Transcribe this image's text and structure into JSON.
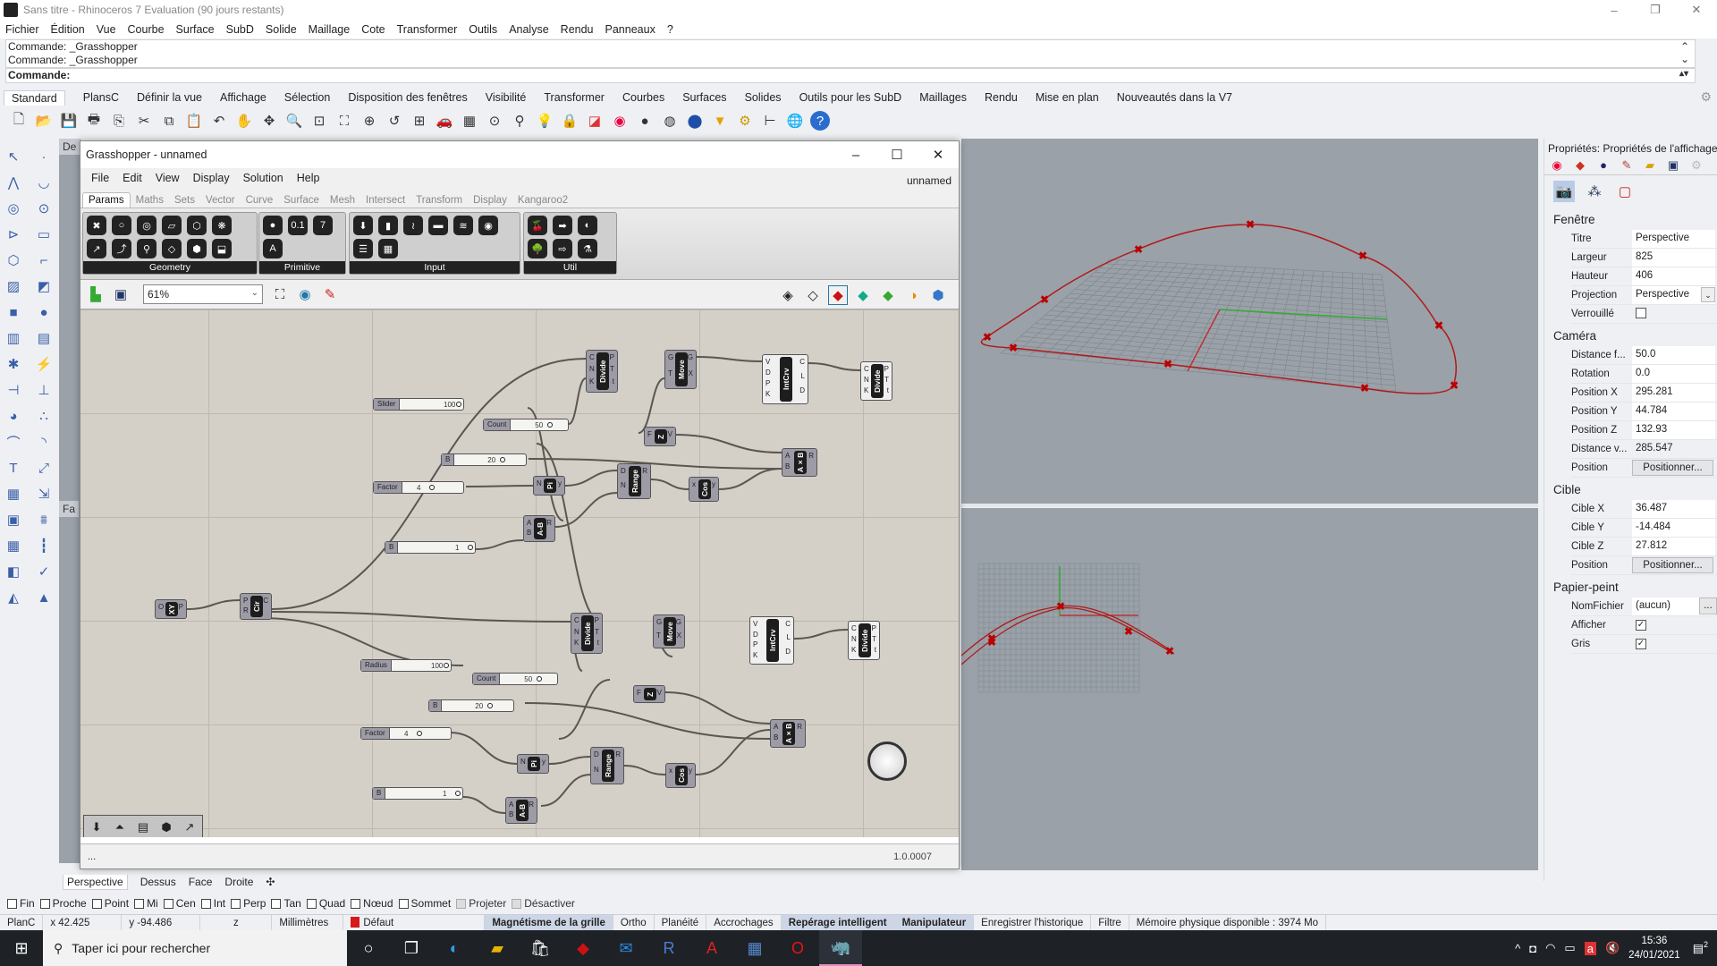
{
  "window": {
    "title": "Sans titre - Rhinoceros 7 Evaluation (90 jours restants)",
    "controls": {
      "minimize": "–",
      "restore": "❐",
      "close": "✕"
    }
  },
  "menubar": [
    "Fichier",
    "Édition",
    "Vue",
    "Courbe",
    "Surface",
    "SubD",
    "Solide",
    "Maillage",
    "Cote",
    "Transformer",
    "Outils",
    "Analyse",
    "Rendu",
    "Panneaux",
    "?"
  ],
  "command": {
    "history": [
      "Commande: _Grasshopper",
      "Commande: _Grasshopper"
    ],
    "prompt": "Commande:"
  },
  "toolbar_tabs": [
    "Standard",
    "PlansC",
    "Définir la vue",
    "Affichage",
    "Sélection",
    "Disposition des fenêtres",
    "Visibilité",
    "Transformer",
    "Courbes",
    "Surfaces",
    "Solides",
    "Outils pour les SubD",
    "Maillages",
    "Rendu",
    "Mise en plan",
    "Nouveautés dans la V7"
  ],
  "toolbar_active_tab": "Standard",
  "standard_toolbar_icons": [
    "new-icon",
    "open-icon",
    "save-icon",
    "print-icon",
    "import-icon",
    "cut-icon",
    "copy-icon",
    "paste-icon",
    "undo-icon",
    "pan-icon",
    "rotate-view-icon",
    "zoom-icon",
    "zoom-window-icon",
    "zoom-extents-icon",
    "zoom-selected-icon",
    "undo-view-icon",
    "viewport-layout-icon",
    "car-icon",
    "grid-icon",
    "osnap-icon",
    "gumball-icon",
    "light-icon",
    "lock-icon",
    "layer-icon",
    "color-wheel-icon",
    "shaded-icon",
    "rendered-icon",
    "sphere-icon",
    "select-icon",
    "options-icon",
    "dimensions-icon",
    "globe-icon",
    "help-icon"
  ],
  "left_tools": [
    [
      "select-arrow-icon",
      "point-icon"
    ],
    [
      "polyline-icon",
      "curve-icon"
    ],
    [
      "circle-icon",
      "ellipse-icon"
    ],
    [
      "arc-icon",
      "rectangle-icon"
    ],
    [
      "polygon-icon",
      "fillet-icon"
    ],
    [
      "surface-points-icon",
      "surface-icon"
    ],
    [
      "box-icon",
      "sphere-solid-icon"
    ],
    [
      "cylinder-icon",
      "mesh-icon"
    ],
    [
      "boolean-icon",
      "explode-icon"
    ],
    [
      "trim-icon",
      "split-icon"
    ],
    [
      "boolean-union-icon",
      "boolean-diff-icon"
    ],
    [
      "offset-icon",
      "fillet-curve-icon"
    ],
    [
      "text-icon",
      "scale-icon"
    ],
    [
      "array-icon",
      "align-icon"
    ],
    [
      "extrude-icon",
      "project-icon"
    ],
    [
      "grid-array-icon",
      "history-icon"
    ],
    [
      "analysis-icon",
      "check-icon"
    ],
    [
      "shapes-icon",
      "render-icon"
    ]
  ],
  "viewport_side_labels": [
    "De",
    "Fa"
  ],
  "viewport_tabs": [
    "Perspective",
    "Dessus",
    "Face",
    "Droite"
  ],
  "viewport_active_tab": "Perspective",
  "osnaps": [
    {
      "label": "Fin",
      "checked": false,
      "enabled": true
    },
    {
      "label": "Proche",
      "checked": false,
      "enabled": true
    },
    {
      "label": "Point",
      "checked": false,
      "enabled": true
    },
    {
      "label": "Mi",
      "checked": false,
      "enabled": true
    },
    {
      "label": "Cen",
      "checked": false,
      "enabled": true
    },
    {
      "label": "Int",
      "checked": false,
      "enabled": true
    },
    {
      "label": "Perp",
      "checked": false,
      "enabled": true
    },
    {
      "label": "Tan",
      "checked": false,
      "enabled": true
    },
    {
      "label": "Quad",
      "checked": false,
      "enabled": true
    },
    {
      "label": "Nœud",
      "checked": false,
      "enabled": true
    },
    {
      "label": "Sommet",
      "checked": false,
      "enabled": true
    },
    {
      "label": "Projeter",
      "checked": false,
      "enabled": false
    },
    {
      "label": "Désactiver",
      "checked": false,
      "enabled": false
    }
  ],
  "statusbar": {
    "cplane": "PlanC",
    "x": "x 42.425",
    "y": "y -94.486",
    "z": "z",
    "units": "Millimètres",
    "layer": "Défaut",
    "layer_color": "#d7191c",
    "toggles": [
      {
        "label": "Magnétisme de la grille",
        "active": true
      },
      {
        "label": "Ortho",
        "active": false
      },
      {
        "label": "Planéité",
        "active": false
      },
      {
        "label": "Accrochages",
        "active": false
      },
      {
        "label": "Repérage intelligent",
        "active": true
      },
      {
        "label": "Manipulateur",
        "active": true
      },
      {
        "label": "Enregistrer l'historique",
        "active": false
      },
      {
        "label": "Filtre",
        "active": false
      }
    ],
    "memory": "Mémoire physique disponible : 3974 Mo"
  },
  "properties": {
    "title": "Propriétés: Propriétés de l'affichage",
    "tab_icons": [
      "color-wheel-icon",
      "material-icon",
      "environment-icon",
      "texture-icon",
      "folder-icon",
      "help-panel-icon",
      "settings-icon"
    ],
    "subtab_icons": [
      "camera-icon",
      "molecule-icon",
      "frame-icon"
    ],
    "sections": {
      "fenetre": {
        "label": "Fenêtre",
        "titre_label": "Titre",
        "titre": "Perspective",
        "largeur_label": "Largeur",
        "largeur": "825",
        "hauteur_label": "Hauteur",
        "hauteur": "406",
        "projection_label": "Projection",
        "projection": "Perspective",
        "verrouille_label": "Verrouillé",
        "verrouille": false
      },
      "camera": {
        "label": "Caméra",
        "focale_label": "Distance f...",
        "focale": "50.0",
        "rotation_label": "Rotation",
        "rotation": "0.0",
        "px_label": "Position X",
        "px": "295.281",
        "py_label": "Position Y",
        "py": "44.784",
        "pz_label": "Position Z",
        "pz": "132.93",
        "dist_label": "Distance v...",
        "dist": "285.547",
        "position_label": "Position",
        "position_button": "Positionner..."
      },
      "cible": {
        "label": "Cible",
        "cx_label": "Cible X",
        "cx": "36.487",
        "cy_label": "Cible Y",
        "cy": "-14.484",
        "cz_label": "Cible Z",
        "cz": "27.812",
        "position_label": "Position",
        "position_button": "Positionner..."
      },
      "papier": {
        "label": "Papier-peint",
        "nomfichier_label": "NomFichier",
        "nomfichier": "(aucun)",
        "browse": "...",
        "afficher_label": "Afficher",
        "afficher": true,
        "gris_label": "Gris",
        "gris": true
      }
    }
  },
  "grasshopper": {
    "title": "Grasshopper - unnamed",
    "doc_name": "unnamed",
    "menu": [
      "File",
      "Edit",
      "View",
      "Display",
      "Solution",
      "Help"
    ],
    "tabs": [
      "Params",
      "Maths",
      "Sets",
      "Vector",
      "Curve",
      "Surface",
      "Mesh",
      "Intersect",
      "Transform",
      "Display",
      "Kangaroo2"
    ],
    "active_tab": "Params",
    "ribbon_groups": [
      {
        "label": "Geometry",
        "icons": [
          "✖",
          "○",
          "◎",
          "▱",
          "⬡",
          "❋",
          "↗",
          "⤴",
          "⚲",
          "◇",
          "⬢",
          "⬓"
        ]
      },
      {
        "label": "Primitive",
        "icons": [
          "●",
          "0.1",
          "7",
          "A"
        ]
      },
      {
        "label": "Input",
        "icons": [
          "⬇",
          "▮",
          "≀",
          "▬",
          "≋",
          "◉",
          "☰",
          "▦"
        ]
      },
      {
        "label": "Util",
        "icons": [
          "🍒",
          "➡",
          "◐",
          "🌳",
          "⇨",
          "⚗"
        ]
      }
    ],
    "zoom": "61%",
    "canvas_tools_left": [
      "open-file-icon",
      "save-file-icon",
      "zoom-extents-icon",
      "preview-eye-icon",
      "sketch-icon"
    ],
    "canvas_tools_right": [
      "wireframe-preview-icon",
      "no-preview-icon",
      "shaded-preview-icon",
      "preview-meshes-icon",
      "preview-selected-icon",
      "material-icon",
      "display-mode-icon"
    ],
    "version": "1.0.0007",
    "status_left": "...",
    "nodes": [
      {
        "name": "Divide",
        "inputs": [
          "C",
          "N",
          "K"
        ],
        "outputs": [
          "P",
          "T",
          "t"
        ]
      },
      {
        "name": "Move",
        "inputs": [
          "G",
          "T"
        ],
        "outputs": [
          "G",
          "X"
        ]
      },
      {
        "name": "IntCrv",
        "inputs": [
          "V",
          "D",
          "P",
          "K"
        ],
        "outputs": [
          "C",
          "L",
          "D"
        ]
      },
      {
        "name": "Divide",
        "inputs": [
          "C",
          "N",
          "K"
        ],
        "outputs": [
          "P",
          "T",
          "t"
        ]
      },
      {
        "name": "Z",
        "inputs": [
          "F"
        ],
        "outputs": [
          "V"
        ]
      },
      {
        "name": "A×B",
        "inputs": [
          "A",
          "B"
        ],
        "outputs": [
          "R"
        ]
      },
      {
        "name": "Pi",
        "inputs": [
          "N"
        ],
        "outputs": [
          "y"
        ]
      },
      {
        "name": "Range",
        "inputs": [
          "D",
          "N"
        ],
        "outputs": [
          "R"
        ]
      },
      {
        "name": "Cos",
        "inputs": [
          "x"
        ],
        "outputs": [
          "y"
        ]
      },
      {
        "name": "A-B",
        "inputs": [
          "A",
          "B"
        ],
        "outputs": [
          "R"
        ]
      },
      {
        "name": "XY",
        "inputs": [
          "O"
        ],
        "outputs": [
          "P"
        ]
      },
      {
        "name": "Cir",
        "inputs": [
          "P",
          "R"
        ],
        "outputs": [
          "C"
        ]
      },
      {
        "name": "Divide",
        "inputs": [
          "C",
          "N",
          "K"
        ],
        "outputs": [
          "P",
          "T",
          "t"
        ]
      },
      {
        "name": "Move",
        "inputs": [
          "G",
          "T"
        ],
        "outputs": [
          "G",
          "X"
        ]
      },
      {
        "name": "IntCrv",
        "inputs": [
          "V",
          "D",
          "P",
          "K"
        ],
        "outputs": [
          "C",
          "L",
          "D"
        ]
      },
      {
        "name": "Divide",
        "inputs": [
          "C",
          "N",
          "K"
        ],
        "outputs": [
          "P",
          "T",
          "t"
        ]
      },
      {
        "name": "Z",
        "inputs": [
          "F"
        ],
        "outputs": [
          "V"
        ]
      },
      {
        "name": "A×B",
        "inputs": [
          "A",
          "B"
        ],
        "outputs": [
          "R"
        ]
      },
      {
        "name": "Pi",
        "inputs": [
          "N"
        ],
        "outputs": [
          "y"
        ]
      },
      {
        "name": "Range",
        "inputs": [
          "D",
          "N"
        ],
        "outputs": [
          "R"
        ]
      },
      {
        "name": "Cos",
        "inputs": [
          "x"
        ],
        "outputs": [
          "y"
        ]
      },
      {
        "name": "A-B",
        "inputs": [
          "A",
          "B"
        ],
        "outputs": [
          "R"
        ]
      }
    ],
    "sliders": [
      {
        "label": "Slider",
        "value": "100",
        "fraction": 1.0
      },
      {
        "label": "Count",
        "value": "50",
        "fraction": 0.7
      },
      {
        "label": "B",
        "value": "20",
        "fraction": 0.7
      },
      {
        "label": "Factor",
        "value": "4",
        "fraction": 0.4
      },
      {
        "label": "B",
        "value": "1",
        "fraction": 1.0
      },
      {
        "label": "Radius",
        "value": "100",
        "fraction": 1.0
      },
      {
        "label": "Count",
        "value": "50",
        "fraction": 0.7
      },
      {
        "label": "B",
        "value": "20",
        "fraction": 0.7
      },
      {
        "label": "Factor",
        "value": "4",
        "fraction": 0.4
      },
      {
        "label": "B",
        "value": "1",
        "fraction": 1.0
      }
    ],
    "bottom_tools": [
      "bake-icon",
      "xy-plane-icon",
      "list-icon",
      "brep-icon",
      "vector-icon"
    ]
  },
  "taskbar": {
    "search_placeholder": "Taper ici pour rechercher",
    "apps": [
      "cortana-icon",
      "task-view-icon",
      "edge-icon",
      "file-explorer-icon",
      "store-icon",
      "acrobat-icon",
      "mail-icon",
      "revit-icon",
      "autocad-icon",
      "calculator-icon",
      "opera-icon",
      "rhino-icon"
    ],
    "active_app": "rhino-icon",
    "time": "15:36",
    "date": "24/01/2021",
    "notifications": "2"
  }
}
